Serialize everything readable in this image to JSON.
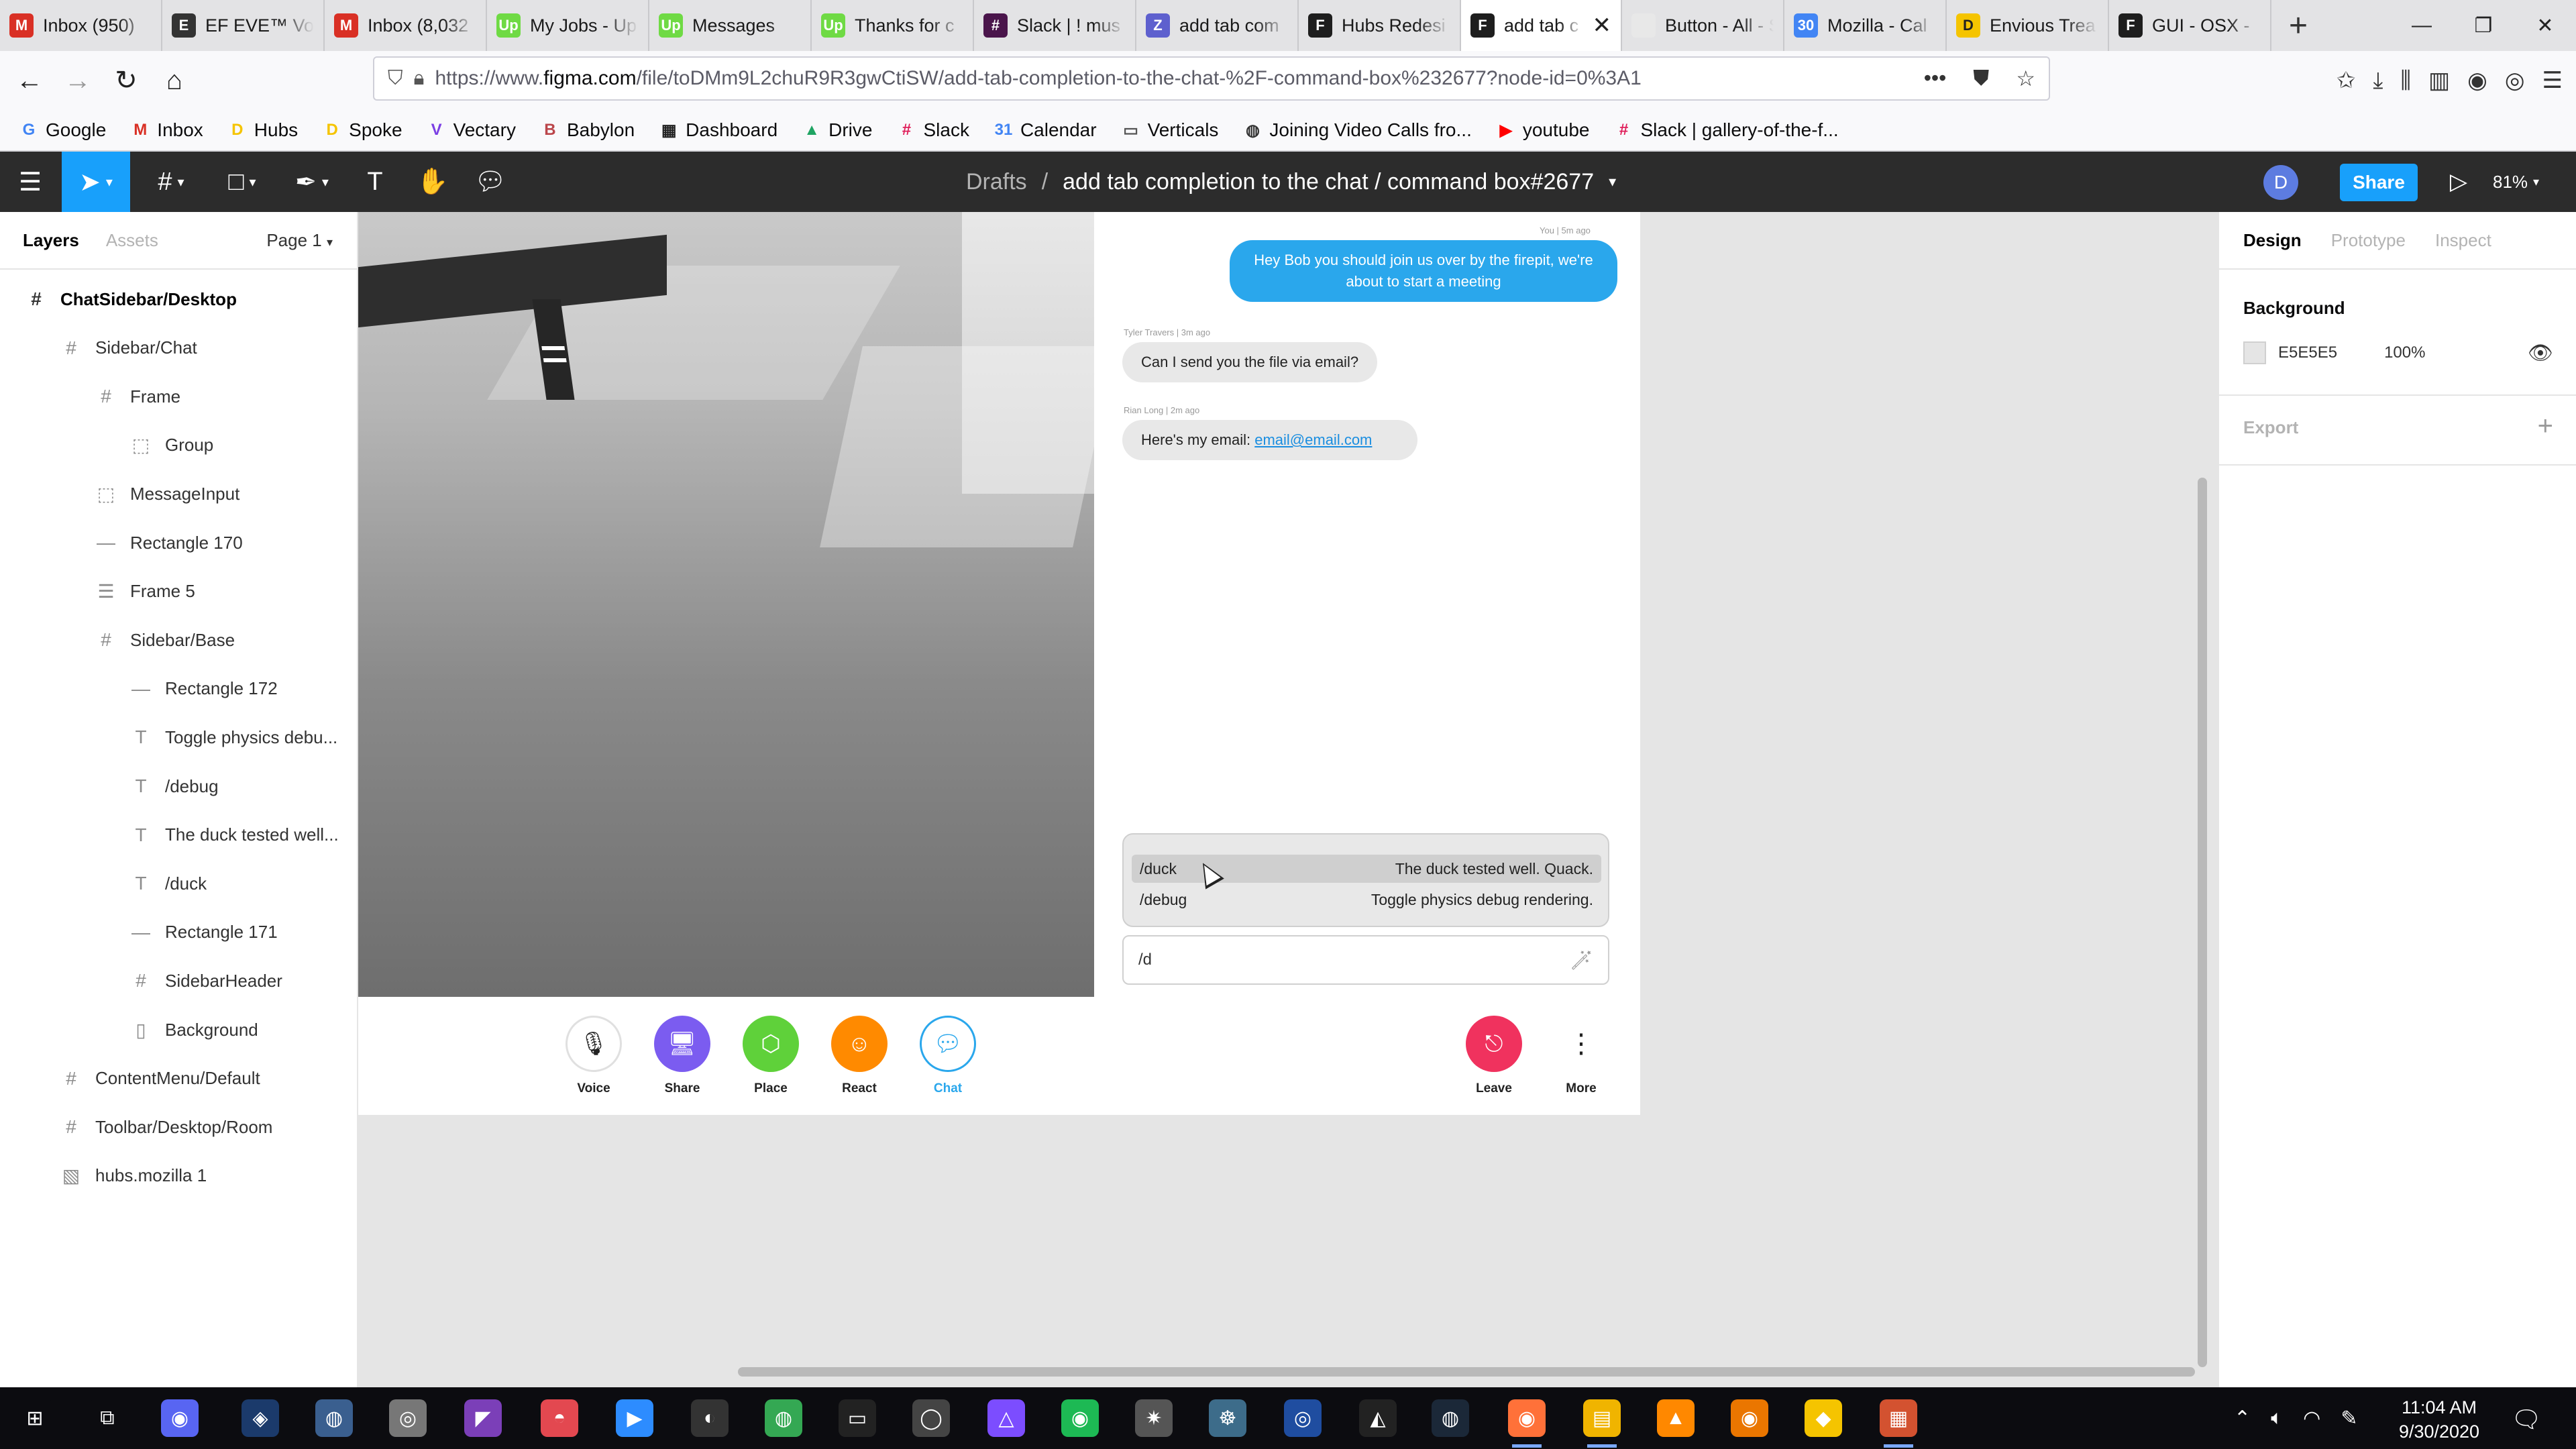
{
  "browser": {
    "tabs": [
      {
        "title": "Inbox (950)",
        "icon": "gmail-icon",
        "color": "#d93025",
        "glyph": "M"
      },
      {
        "title": "EF EVE™ Vol",
        "icon": "ef-icon",
        "color": "#333333",
        "glyph": "E"
      },
      {
        "title": "Inbox (8,032",
        "icon": "gmail-icon",
        "color": "#d93025",
        "glyph": "M"
      },
      {
        "title": "My Jobs - Up",
        "icon": "upwork-icon",
        "color": "#6fda44",
        "glyph": "Up"
      },
      {
        "title": "Messages",
        "icon": "upwork-icon",
        "color": "#6fda44",
        "glyph": "Up"
      },
      {
        "title": "Thanks for c",
        "icon": "upwork-icon",
        "color": "#6fda44",
        "glyph": "Up"
      },
      {
        "title": "Slack | ! mus",
        "icon": "slack-icon",
        "color": "#4a154b",
        "glyph": "#"
      },
      {
        "title": "add tab com",
        "icon": "zenhub-icon",
        "color": "#5e60ce",
        "glyph": "Z"
      },
      {
        "title": "Hubs Redesi",
        "icon": "figma-icon",
        "color": "#1e1e1e",
        "glyph": "F"
      },
      {
        "title": "add tab c",
        "icon": "figma-icon",
        "color": "#1e1e1e",
        "glyph": "F",
        "active": true
      },
      {
        "title": "Button - All - Sto",
        "icon": "storybook-icon",
        "color": "#e8e8e8",
        "glyph": ""
      },
      {
        "title": "Mozilla - Cal",
        "icon": "calendar-icon",
        "color": "#4285f4",
        "glyph": "30"
      },
      {
        "title": "Envious Trea",
        "icon": "duck-icon",
        "color": "#f5c400",
        "glyph": "D"
      },
      {
        "title": "GUI - OSX -",
        "icon": "figma-icon",
        "color": "#1e1e1e",
        "glyph": "F"
      }
    ],
    "url_prefix": "https://www.",
    "url_domain": "figma.com",
    "url_rest": "/file/toDMm9L2chuR9R3gwCtiSW/add-tab-completion-to-the-chat-%2F-command-box%232677?node-id=0%3A1",
    "bookmarks": [
      {
        "label": "Google",
        "glyph": "G",
        "color": "#4285f4"
      },
      {
        "label": "Inbox",
        "glyph": "M",
        "color": "#d93025"
      },
      {
        "label": "Hubs",
        "glyph": "D",
        "color": "#f5c400"
      },
      {
        "label": "Spoke",
        "glyph": "D",
        "color": "#f5c400"
      },
      {
        "label": "Vectary",
        "glyph": "V",
        "color": "#7b3fe4"
      },
      {
        "label": "Babylon",
        "glyph": "B",
        "color": "#bb464b"
      },
      {
        "label": "Dashboard",
        "glyph": "▦",
        "color": "#222222"
      },
      {
        "label": "Drive",
        "glyph": "▲",
        "color": "#1fa463"
      },
      {
        "label": "Slack",
        "glyph": "#",
        "color": "#e01e5a"
      },
      {
        "label": "Calendar",
        "glyph": "31",
        "color": "#4285f4"
      },
      {
        "label": "Verticals",
        "glyph": "▭",
        "color": "#555555"
      },
      {
        "label": "Joining Video Calls fro...",
        "glyph": "◍",
        "color": "#333333"
      },
      {
        "label": "youtube",
        "glyph": "▶",
        "color": "#ff0000"
      },
      {
        "label": "Slack | gallery-of-the-f...",
        "glyph": "#",
        "color": "#e01e5a"
      }
    ]
  },
  "figma": {
    "breadcrumb_root": "Drafts",
    "breadcrumb_sep": "/",
    "file_title": "add tab completion to the chat / command box#2677",
    "avatar_initial": "D",
    "share_label": "Share",
    "zoom": "81%",
    "left_tabs": {
      "layers": "Layers",
      "assets": "Assets",
      "page": "Page 1"
    },
    "layers": [
      {
        "name": "ChatSidebar/Desktop",
        "indent": 0,
        "icon": "#",
        "top": true
      },
      {
        "name": "Sidebar/Chat",
        "indent": 1,
        "icon": "#"
      },
      {
        "name": "Frame",
        "indent": 2,
        "icon": "#"
      },
      {
        "name": "Group",
        "indent": 3,
        "icon": "⬚"
      },
      {
        "name": "MessageInput",
        "indent": 2,
        "icon": "⬚"
      },
      {
        "name": "Rectangle 170",
        "indent": 2,
        "icon": "—"
      },
      {
        "name": "Frame 5",
        "indent": 2,
        "icon": "☰"
      },
      {
        "name": "Sidebar/Base",
        "indent": 2,
        "icon": "#"
      },
      {
        "name": "Rectangle 172",
        "indent": 3,
        "icon": "—"
      },
      {
        "name": "Toggle physics debu...",
        "indent": 3,
        "icon": "T"
      },
      {
        "name": "/debug",
        "indent": 3,
        "icon": "T"
      },
      {
        "name": "The duck tested well...",
        "indent": 3,
        "icon": "T"
      },
      {
        "name": "/duck",
        "indent": 3,
        "icon": "T"
      },
      {
        "name": "Rectangle 171",
        "indent": 3,
        "icon": "—"
      },
      {
        "name": "SidebarHeader",
        "indent": 3,
        "icon": "#"
      },
      {
        "name": "Background",
        "indent": 3,
        "icon": "▯"
      },
      {
        "name": "ContentMenu/Default",
        "indent": 1,
        "icon": "#"
      },
      {
        "name": "Toolbar/Desktop/Room",
        "indent": 1,
        "icon": "#"
      },
      {
        "name": "hubs.mozilla 1",
        "indent": 1,
        "icon": "▧"
      }
    ],
    "right_tabs": {
      "design": "Design",
      "prototype": "Prototype",
      "inspect": "Inspect"
    },
    "background_title": "Background",
    "background_hex": "E5E5E5",
    "background_color": "#e5e5e5",
    "background_opacity": "100%",
    "export_label": "Export"
  },
  "chat": {
    "messages": [
      {
        "meta": "You  |  5m ago",
        "text": "Hey Bob you should join us over by the firepit, we're about to start a meeting",
        "mine": true
      },
      {
        "meta": "Tyler Travers  |  3m ago",
        "text": "Can I send you the file via email?",
        "mine": false
      },
      {
        "meta": "Rian Long  |  2m ago",
        "text_prefix": "Here's my email: ",
        "link": "email@email.com",
        "mine": false
      }
    ],
    "completions": [
      {
        "command": "/duck",
        "description": "The duck tested well. Quack."
      },
      {
        "command": "/debug",
        "description": "Toggle physics debug rendering."
      }
    ],
    "input_value": "/d"
  },
  "hubs_toolbar": {
    "buttons": [
      {
        "label": "Voice",
        "color": "#ffffff"
      },
      {
        "label": "Share",
        "color": "#7b5cf0"
      },
      {
        "label": "Place",
        "color": "#5fd13a"
      },
      {
        "label": "React",
        "color": "#ff8a00"
      },
      {
        "label": "Chat",
        "color": "#ffffff"
      }
    ],
    "leave_label": "Leave",
    "leave_color": "#f0325e",
    "more_label": "More"
  },
  "taskbar": {
    "time": "11:04 AM",
    "date": "9/30/2020"
  }
}
